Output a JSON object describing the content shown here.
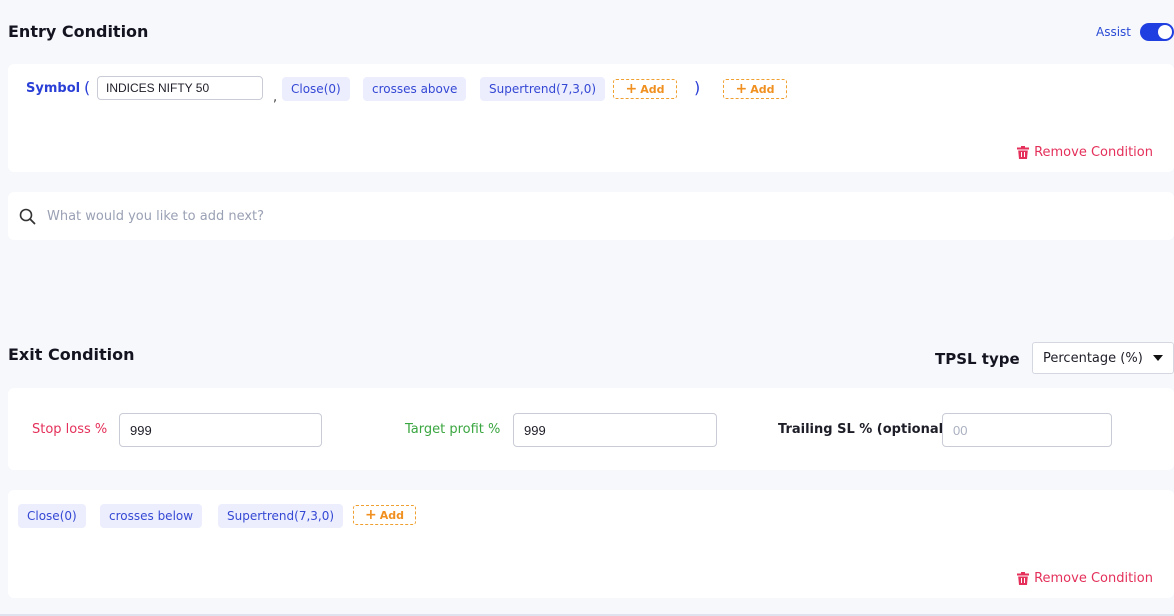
{
  "entry": {
    "title": "Entry Condition",
    "assist_label": "Assist",
    "assist_on": true,
    "symbol_label": "Symbol",
    "open_paren": "(",
    "close_paren": ")",
    "comma": ",",
    "symbol_value": "INDICES NIFTY 50",
    "chips": [
      "Close(0)",
      "crosses above",
      "Supertrend(7,3,0)"
    ],
    "add_label": "Add",
    "remove_label": "Remove Condition"
  },
  "search": {
    "placeholder": "What would you like to add next?"
  },
  "exit": {
    "title": "Exit Condition",
    "tpsl_label": "TPSL type",
    "tpsl_value": "Percentage (%)",
    "stop_loss_label": "Stop loss %",
    "stop_loss_value": "999",
    "target_label": "Target profit %",
    "target_value": "999",
    "trailing_label": "Trailing SL % (optional)",
    "trailing_placeholder": "00",
    "chips": [
      "Close(0)",
      "crosses below",
      "Supertrend(7,3,0)"
    ],
    "add_label": "Add",
    "remove_label": "Remove Condition"
  },
  "colors": {
    "accent": "#2a3fd6",
    "chip_bg": "#eceefe",
    "add_orange": "#f09020",
    "remove_red": "#e4305a",
    "stop_loss_red": "#e4305a",
    "target_green": "#3aa640"
  }
}
